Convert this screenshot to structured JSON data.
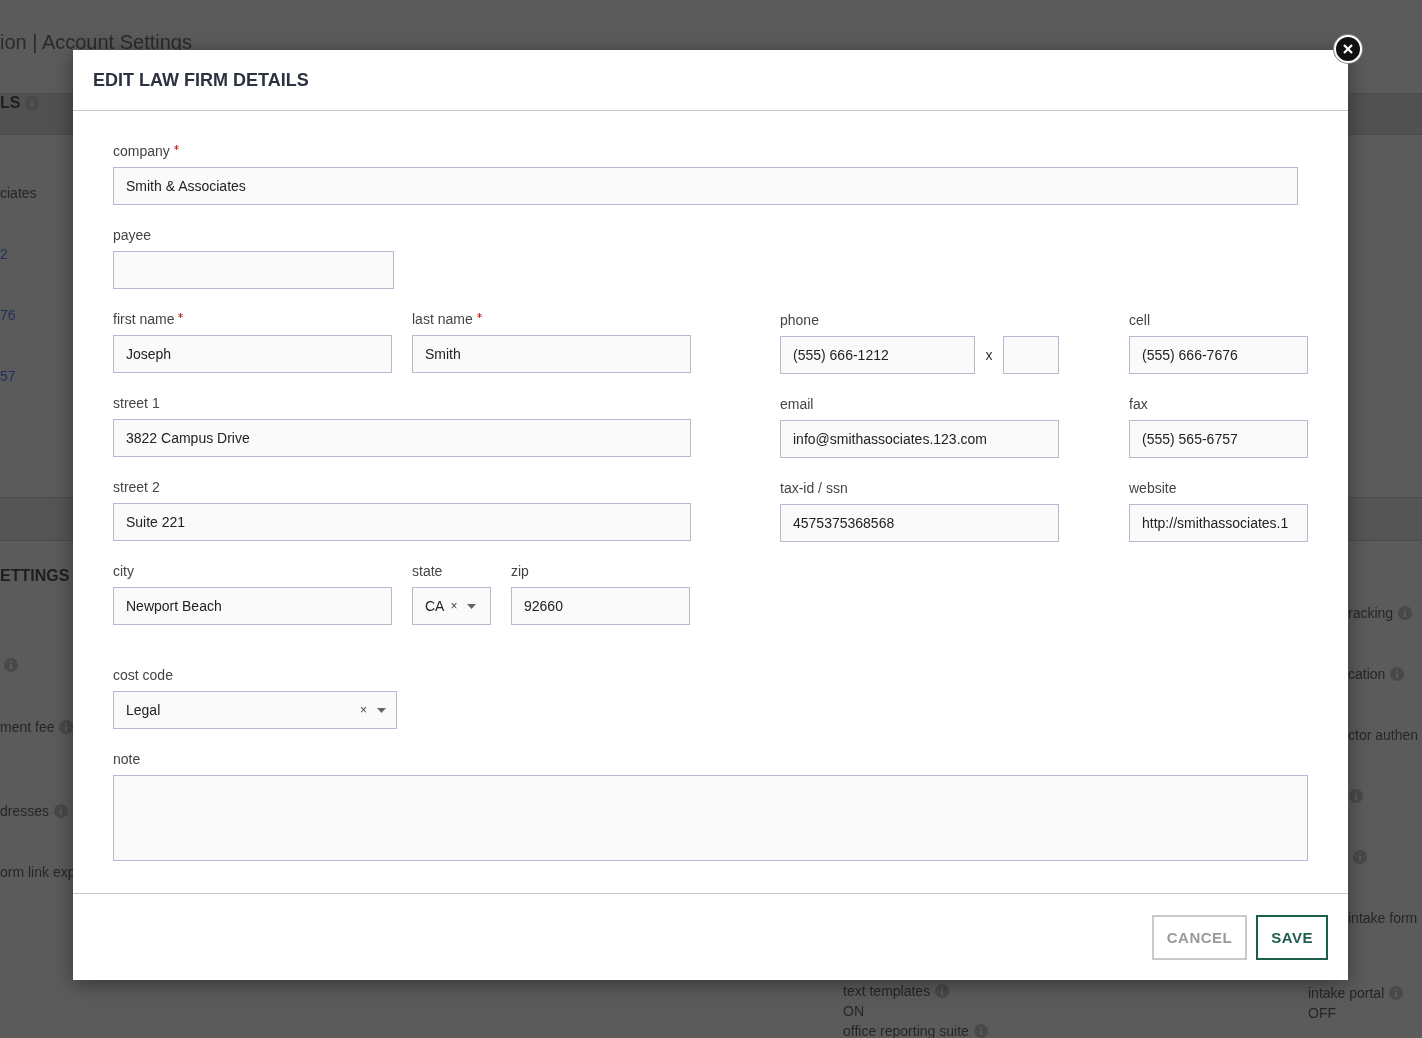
{
  "background": {
    "title": "ion | Account Settings",
    "section_heading": {
      "label": "LS",
      "info": true
    },
    "left_items": [
      {
        "text": "ciates",
        "kind": "text"
      },
      {
        "text": "2",
        "kind": "link"
      },
      {
        "text": "76",
        "kind": "link"
      },
      {
        "text": "57",
        "kind": "link"
      }
    ],
    "settings_heading": "ETTINGS",
    "left_settings": [
      {
        "info": true
      },
      {
        "label": "ment fee",
        "info": true
      },
      {
        "label": "dresses",
        "info": true
      },
      {
        "label": "orm link exp",
        "info": false
      }
    ],
    "middle_settings": [
      {
        "label": "text templates",
        "info": true,
        "value": "ON"
      },
      {
        "label": "office reporting suite",
        "info": true
      }
    ],
    "right_settings": [
      {
        "label": "racking",
        "info": true
      },
      {
        "label": "cation",
        "info": true
      },
      {
        "label": "ctor authen",
        "info": false
      },
      {
        "info": true
      },
      {
        "info": true
      },
      {
        "label": "intake form",
        "info": false
      },
      {
        "label": "intake portal",
        "info": true,
        "value": "OFF"
      }
    ]
  },
  "modal": {
    "title": "EDIT LAW FIRM DETAILS",
    "company": {
      "label": "company",
      "required": true,
      "value": "Smith & Associates"
    },
    "payee": {
      "label": "payee",
      "required": false
    },
    "first_name": {
      "label": "first name",
      "required": true,
      "value": "Joseph"
    },
    "last_name": {
      "label": "last name",
      "required": true,
      "value": "Smith"
    },
    "street_1": {
      "label": "street 1",
      "required": false,
      "value": "3822 Campus Drive"
    },
    "street_2": {
      "label": "street 2",
      "required": false,
      "value": "Suite 221"
    },
    "city": {
      "label": "city",
      "required": false,
      "value": "Newport Beach"
    },
    "state": {
      "label": "state",
      "required": false,
      "value": "CA",
      "clear": "×"
    },
    "zip": {
      "label": "zip",
      "required": false,
      "value": "92660"
    },
    "cost_code": {
      "label": "cost code",
      "required": false,
      "value": "Legal",
      "clear": "×"
    },
    "note": {
      "label": "note",
      "required": false
    },
    "phone": {
      "label": "phone",
      "required": false,
      "value": "(555) 666-1212",
      "ext_separator": "x"
    },
    "cell": {
      "label": "cell",
      "required": false,
      "value": "(555) 666-7676"
    },
    "email": {
      "label": "email",
      "required": false,
      "value": "info@smithassociates.123.com"
    },
    "fax": {
      "label": "fax",
      "required": false,
      "value": "(555) 565-6757"
    },
    "tax_id": {
      "label": "tax-id / ssn",
      "required": false,
      "value": "4575375368568"
    },
    "website": {
      "label": "website",
      "required": false,
      "value": "http://smithassociates.1"
    },
    "buttons": [
      {
        "label": "CANCEL",
        "kind": "secondary"
      },
      {
        "label": "SAVE",
        "kind": "primary"
      }
    ]
  }
}
